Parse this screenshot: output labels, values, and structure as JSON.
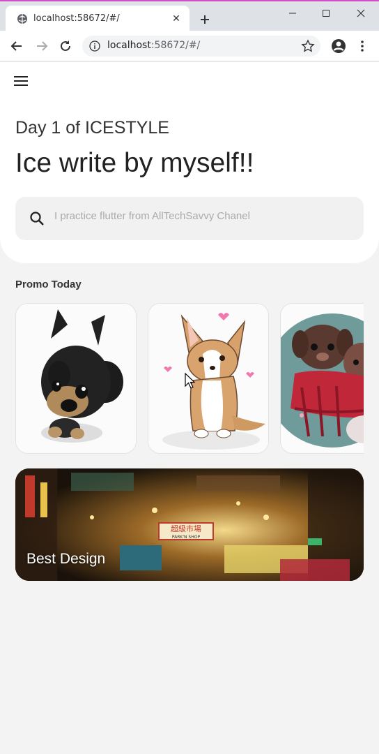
{
  "browser": {
    "tab_title": "localhost:58672/#/",
    "url_host": "localhost",
    "url_path": ":58672/#/",
    "tab_close_icon": "close-icon",
    "new_tab_icon": "plus-icon"
  },
  "app": {
    "menu_icon": "hamburger-menu-icon",
    "subtitle": "Day 1 of ICESTYLE",
    "title": "Ice write by myself!!",
    "search": {
      "placeholder": "I practice flutter from AllTechSavvy Chanel",
      "icon": "search-icon"
    },
    "promo_section_title": "Promo Today",
    "promo_cards": [
      {
        "subject": "puppy illustration"
      },
      {
        "subject": "corgi illustration"
      },
      {
        "subject": "dogs with scarf illustration"
      }
    ],
    "banner": {
      "label": "Best Design",
      "sign_text": "超級市場",
      "sign_sub": "PARK'N SHOP"
    }
  },
  "colors": {
    "background": "#f3f3f3",
    "card": "#ffffff",
    "search_bg": "#f1f1f1",
    "text_dark": "#222222",
    "chrome_accent": "#d04ec9"
  }
}
